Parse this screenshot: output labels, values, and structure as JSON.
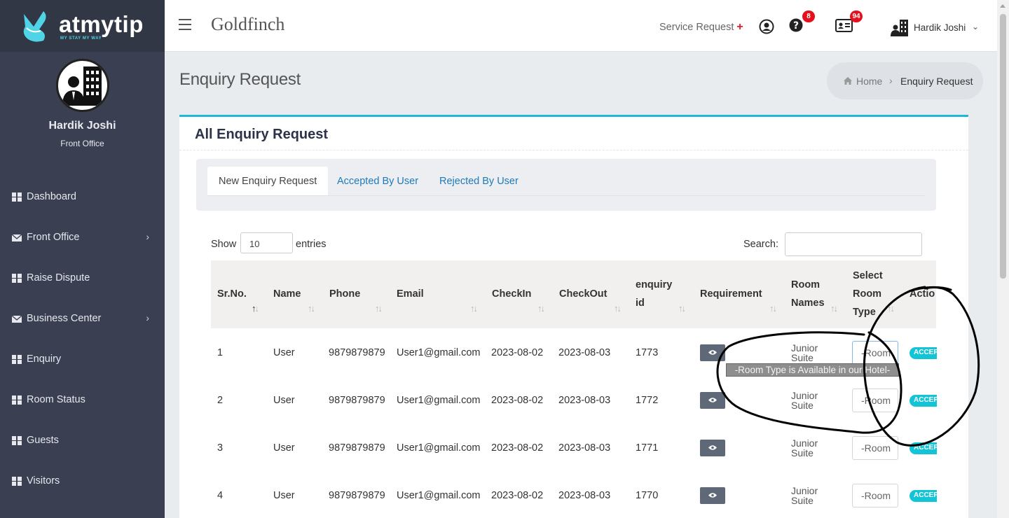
{
  "brand": {
    "name": "atmytip",
    "tagline": "MY STAY MY WAY"
  },
  "profile": {
    "name": "Hardik Joshi",
    "role": "Front Office"
  },
  "sidebar": {
    "items": [
      {
        "label": "Dashboard",
        "icon": "grid-icon"
      },
      {
        "label": "Front Office",
        "icon": "envelope-icon",
        "chevron": "›"
      },
      {
        "label": "Raise Dispute",
        "icon": "grid-icon"
      },
      {
        "label": "Business Center",
        "icon": "envelope-icon",
        "chevron": "›"
      },
      {
        "label": "Enquiry",
        "icon": "grid-icon"
      },
      {
        "label": "Room Status",
        "icon": "grid-icon"
      },
      {
        "label": "Guests",
        "icon": "grid-icon"
      },
      {
        "label": "Visitors",
        "icon": "grid-icon"
      }
    ]
  },
  "header": {
    "hotel_name": "Goldfinch",
    "service_request": "Service Request",
    "service_plus": "+",
    "help_badge": "8",
    "card_badge": "94",
    "user_name": "Hardik Joshi",
    "user_caret": "⌄"
  },
  "page": {
    "title": "Enquiry Request",
    "breadcrumb": {
      "home": "Home",
      "sep": "›",
      "current": "Enquiry Request"
    }
  },
  "card": {
    "title": "All Enquiry Request",
    "tabs": [
      "New Enquiry Request",
      "Accepted By User",
      "Rejected By User"
    ]
  },
  "table_controls": {
    "show": "Show",
    "entries_value": "10",
    "entries": "entries",
    "search": "Search:"
  },
  "table": {
    "columns": {
      "srno": "Sr.No.",
      "name": "Name",
      "phone": "Phone",
      "email": "Email",
      "checkin": "CheckIn",
      "checkout": "CheckOut",
      "enquiry_l1": "enquiry",
      "enquiry_l2": "id",
      "requirement": "Requirement",
      "room_l1": "Room",
      "room_l2": "Names",
      "select_l1": "Select",
      "select_l2": "Room",
      "select_l3": "Type",
      "action": "Actio"
    },
    "sort_glyph": "↑↓",
    "rows": [
      {
        "sr": "1",
        "name": "User",
        "phone": "9879879879",
        "email": "User1@gmail.com",
        "checkin": "2023-08-02",
        "checkout": "2023-08-03",
        "enquiry_id": "1773",
        "room_l1": "Junior",
        "room_l2": "Suite",
        "select": "-Room",
        "action": "ACCEPT"
      },
      {
        "sr": "2",
        "name": "User",
        "phone": "9879879879",
        "email": "User1@gmail.com",
        "checkin": "2023-08-02",
        "checkout": "2023-08-03",
        "enquiry_id": "1772",
        "room_l1": "Junior",
        "room_l2": "Suite",
        "select": "-Room",
        "action": "ACCEPT"
      },
      {
        "sr": "3",
        "name": "User",
        "phone": "9879879879",
        "email": "User1@gmail.com",
        "checkin": "2023-08-02",
        "checkout": "2023-08-03",
        "enquiry_id": "1771",
        "room_l1": "Junior",
        "room_l2": "Suite",
        "select": "-Room",
        "action": "ACCEPT"
      },
      {
        "sr": "4",
        "name": "User",
        "phone": "9879879879",
        "email": "User1@gmail.com",
        "checkin": "2023-08-02",
        "checkout": "2023-08-03",
        "enquiry_id": "1770",
        "room_l1": "Junior",
        "room_l2": "Suite",
        "select": "-Room",
        "action": "ACCEPT"
      }
    ]
  },
  "tooltip": "-Room Type is Available in our Hotel-",
  "colors": {
    "sidebar": "#3a3f51",
    "accent": "#1cb7d9",
    "badge": "#e3101d",
    "accept": "#12c4d6"
  }
}
